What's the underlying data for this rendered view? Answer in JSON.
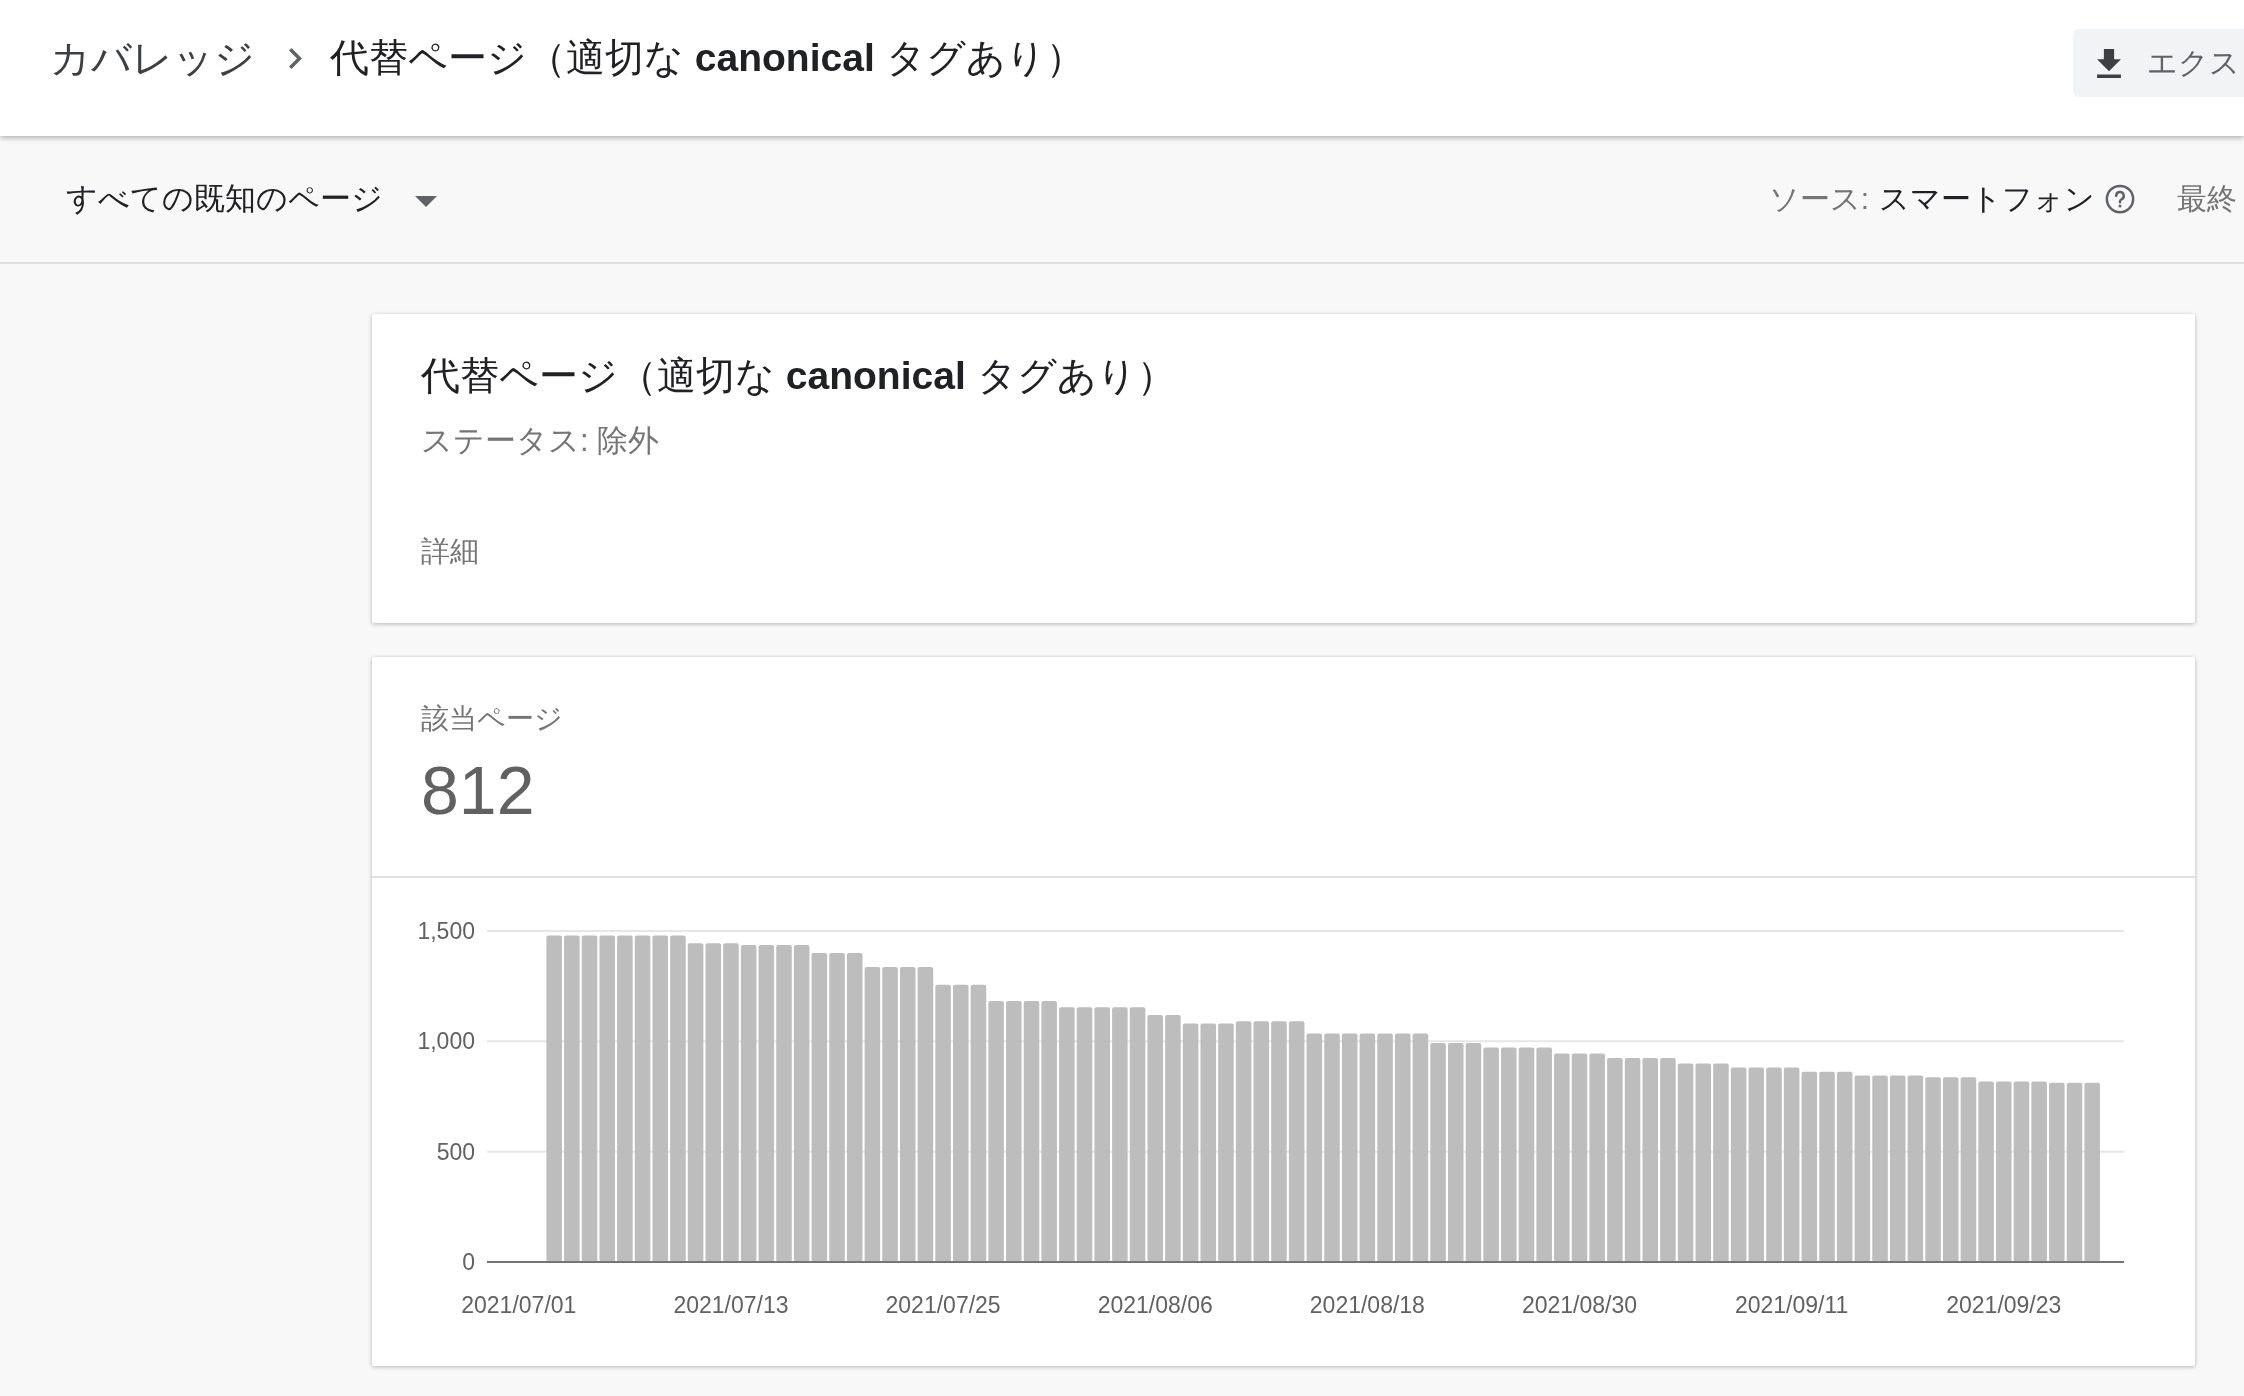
{
  "header": {
    "breadcrumb": {
      "parent": "カバレッジ",
      "current": "代替ページ（適切な **canonical** タグあり）"
    },
    "export_button": {
      "label": "エクス"
    }
  },
  "filter_bar": {
    "page_filter": {
      "value": "すべての既知のページ"
    },
    "source": {
      "label": "ソース:",
      "value": "スマートフォン"
    },
    "last_updated": {
      "label": "最終"
    }
  },
  "summary_card": {
    "title": "代替ページ（適切な **canonical** タグあり）",
    "status": "ステータス: 除外",
    "details_label": "詳細"
  },
  "pages_card": {
    "label": "該当ページ",
    "count": "812",
    "chart_data": {
      "type": "bar",
      "categories": [
        "2021/07/01",
        null,
        null,
        null,
        null,
        null,
        null,
        null,
        null,
        null,
        null,
        null,
        "2021/07/13",
        null,
        null,
        null,
        null,
        null,
        null,
        null,
        null,
        null,
        null,
        null,
        "2021/07/25",
        null,
        null,
        null,
        null,
        null,
        null,
        null,
        null,
        null,
        null,
        null,
        "2021/08/06",
        null,
        null,
        null,
        null,
        null,
        null,
        null,
        null,
        null,
        null,
        null,
        "2021/08/18",
        null,
        null,
        null,
        null,
        null,
        null,
        null,
        null,
        null,
        null,
        null,
        "2021/08/30",
        null,
        null,
        null,
        null,
        null,
        null,
        null,
        null,
        null,
        null,
        null,
        "2021/09/11",
        null,
        null,
        null,
        null,
        null,
        null,
        null,
        null,
        null,
        null,
        null,
        "2021/09/23",
        null,
        null,
        null,
        null,
        null
      ],
      "values": [
        null,
        null,
        1480,
        1480,
        1480,
        1480,
        1480,
        1480,
        1480,
        1480,
        1445,
        1445,
        1445,
        1436,
        1436,
        1436,
        1436,
        1400,
        1400,
        1400,
        1337,
        1337,
        1337,
        1337,
        1256,
        1256,
        1256,
        1183,
        1183,
        1183,
        1183,
        1154,
        1154,
        1154,
        1154,
        1154,
        1119,
        1119,
        1081,
        1081,
        1081,
        1091,
        1091,
        1091,
        1091,
        1036,
        1036,
        1036,
        1036,
        1036,
        1036,
        1036,
        992,
        992,
        992,
        972,
        972,
        972,
        972,
        945,
        945,
        945,
        925,
        925,
        925,
        925,
        900,
        900,
        900,
        881,
        881,
        881,
        881,
        862,
        862,
        862,
        845,
        845,
        845,
        845,
        837,
        837,
        837,
        818,
        818,
        818,
        818,
        812,
        812,
        812
      ],
      "ylim": [
        0,
        1500
      ],
      "yticks": [
        {
          "value": 0,
          "label": "0"
        },
        {
          "value": 500,
          "label": "500"
        },
        {
          "value": 1000,
          "label": "1,000"
        },
        {
          "value": 1500,
          "label": "1,500"
        }
      ]
    }
  }
}
